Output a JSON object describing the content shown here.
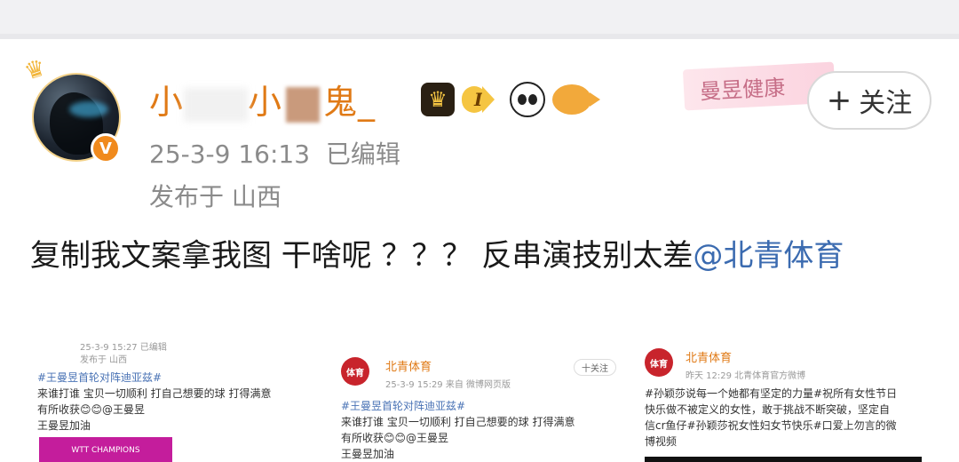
{
  "post": {
    "username_prefix": "小",
    "username_mid": "小",
    "username_suffix": "鬼_",
    "level_badge": "I",
    "time": "25-3-9 16:13",
    "edited": "已编辑",
    "location": "发布于 山西",
    "follow_label": "关注",
    "deco_banner": "曼昱健康",
    "text_main": "复制我文案拿我图  干啥呢 ？？？  反串演技别太差",
    "text_mention": "@北青体育"
  },
  "icons": [
    "crown-icon",
    "verified-v-icon",
    "level-crown-icon",
    "panda-icon",
    "fish-icon",
    "plus-icon"
  ],
  "colors": {
    "username": "#e07a16",
    "mention": "#3b6bb0",
    "meta": "#8b8b8b"
  },
  "embedded": {
    "card1": {
      "meta": "25-3-9 15:27  已编辑",
      "loc": "发布于 山西",
      "hashtag": "#王曼昱首轮对阵迪亚兹#",
      "line1": "来谁打谁 宝贝一切顺利 打自己想要的球 打得满意",
      "line2": "有所收获😊😊@王曼昱",
      "line3": "王曼昱加油",
      "img_text": "WTT CHAMPIONS"
    },
    "card2": {
      "name": "北青体育",
      "avatar": "体育",
      "follow": "十关注",
      "meta": "25-3-9 15:29  来自 微博网页版",
      "hashtag": "#王曼昱首轮对阵迪亚兹#",
      "line1": "来谁打谁 宝贝一切顺利 打自己想要的球 打得满意",
      "line2": "有所收获😊😊@王曼昱",
      "line3": "王曼昱加油"
    },
    "card3": {
      "name": "北青体育",
      "avatar": "体育",
      "meta": "昨天 12:29  北青体育官方微博",
      "line1": "#孙颖莎说每一个她都有坚定的力量#祝所有女性节日",
      "line2": "快乐做不被定义的女性，敢于挑战不断突破，坚定自",
      "line3": "信cr鱼仔#孙颖莎祝女性妇女节快乐#口爱上勿言的微",
      "line4": "博视频"
    }
  }
}
